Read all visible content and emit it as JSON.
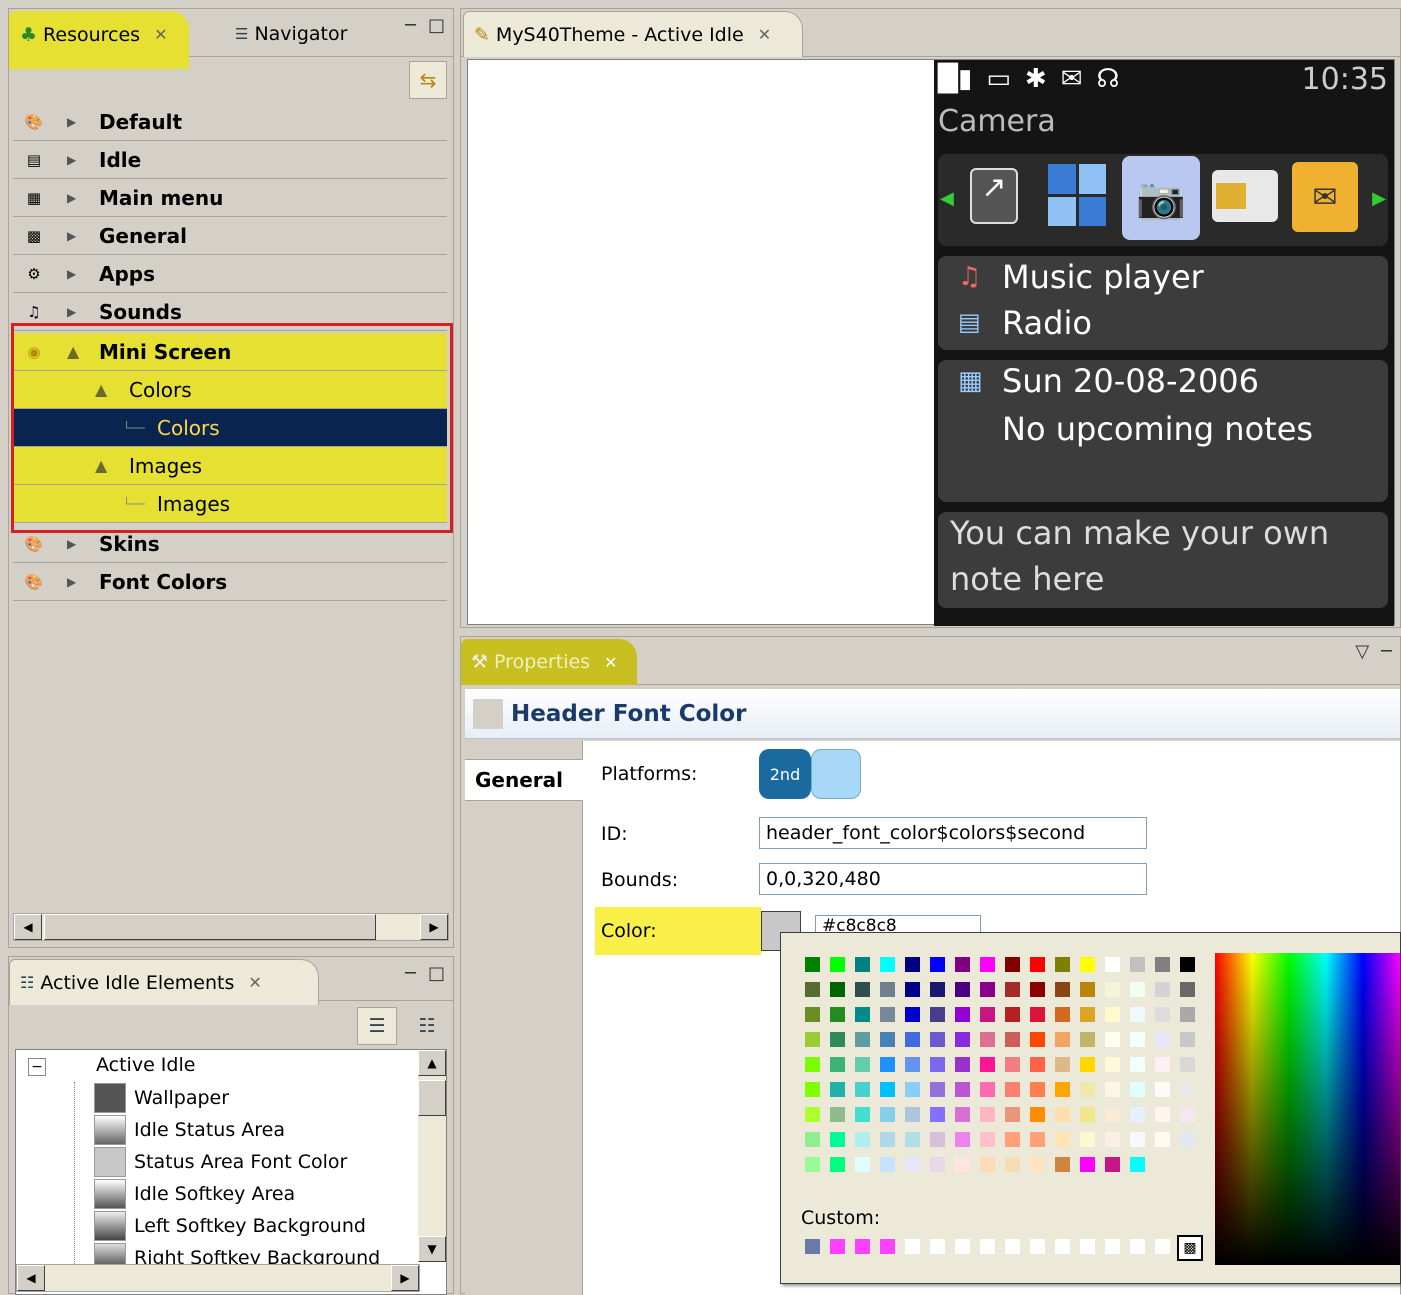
{
  "resources_panel": {
    "tabs": [
      {
        "label": "Resources"
      },
      {
        "label": "Navigator"
      }
    ],
    "tree": [
      {
        "label": "Default",
        "icon": "palette-icon"
      },
      {
        "label": "Idle",
        "icon": "window-icon"
      },
      {
        "label": "Main menu",
        "icon": "grid-icon"
      },
      {
        "label": "General",
        "icon": "panel-icon"
      },
      {
        "label": "Apps",
        "icon": "apps-icon"
      },
      {
        "label": "Sounds",
        "icon": "music-note-icon"
      },
      {
        "label": "Mini Screen",
        "icon": "mini-screen-icon"
      },
      {
        "label": "Colors"
      },
      {
        "label": "Colors"
      },
      {
        "label": "Images"
      },
      {
        "label": "Images"
      },
      {
        "label": "Skins",
        "icon": "palette-icon"
      },
      {
        "label": "Font Colors",
        "icon": "palette-icon"
      }
    ]
  },
  "elements_panel": {
    "tab_label": "Active Idle Elements",
    "root": "Active Idle",
    "items": [
      {
        "label": "Wallpaper",
        "swatch": "#555555"
      },
      {
        "label": "Idle Status Area",
        "swatch": "#888888"
      },
      {
        "label": "Status Area Font Color",
        "swatch": "#c8c8c8"
      },
      {
        "label": "Idle Softkey Area",
        "swatch": "#999999"
      },
      {
        "label": "Left Softkey Background",
        "swatch": "#777777"
      },
      {
        "label": "Right Softkey Background",
        "swatch": "#666666"
      }
    ]
  },
  "editor": {
    "tab_label": "MyS40Theme - Active Idle",
    "phone": {
      "time": "10:35",
      "title": "Camera",
      "app_icons": [
        "shortcut-icon",
        "windows-icon",
        "camera-icon",
        "sim-icon",
        "voicemail-icon"
      ],
      "music": "Music player",
      "radio": "Radio",
      "date": "Sun 20-08-2006",
      "notes": "No upcoming notes",
      "note_line1": "You can make your own",
      "note_line2": "note here"
    }
  },
  "properties": {
    "tab_label": "Properties",
    "header": "Header Font Color",
    "side_tab": "General",
    "platforms_label": "Platforms:",
    "platform_badge": "2nd",
    "id_label": "ID:",
    "id_value": "header_font_color$colors$second",
    "bounds_label": "Bounds:",
    "bounds_value": "0,0,320,480",
    "color_label": "Color:",
    "color_value": "#c8c8c8"
  },
  "color_picker": {
    "custom_label": "Custom:",
    "palette": [
      "#008000",
      "#00ff00",
      "#008080",
      "#00ffff",
      "#000080",
      "#0000ff",
      "#800080",
      "#ff00ff",
      "#800000",
      "#ff0000",
      "#808000",
      "#ffff00",
      "#ffffff",
      "#c0c0c0",
      "#808080",
      "#000000",
      "#556b2f",
      "#006400",
      "#2f4f4f",
      "#708090",
      "#00008b",
      "#191970",
      "#4b0082",
      "#8b008b",
      "#a52a2a",
      "#8b0000",
      "#8b4513",
      "#b8860b",
      "#f5f5dc",
      "#f0fff0",
      "#d3d3d3",
      "#696969",
      "#6b8e23",
      "#228b22",
      "#008b8b",
      "#778899",
      "#0000cd",
      "#483d8b",
      "#9400d3",
      "#c71585",
      "#b22222",
      "#dc143c",
      "#d2691e",
      "#daa520",
      "#fffacd",
      "#f0f8ff",
      "#dcdcdc",
      "#a9a9a9",
      "#9acd32",
      "#2e8b57",
      "#5f9ea0",
      "#4682b4",
      "#4169e1",
      "#6a5acd",
      "#8a2be2",
      "#db7093",
      "#cd5c5c",
      "#ff4500",
      "#f4a460",
      "#bdb76b",
      "#fffff0",
      "#f5fffa",
      "#e6e6fa",
      "#c8c8c8",
      "#7cfc00",
      "#3cb371",
      "#66cdaa",
      "#1e90ff",
      "#6495ed",
      "#7b68ee",
      "#9932cc",
      "#ff1493",
      "#f08080",
      "#ff6347",
      "#deb887",
      "#ffd700",
      "#fff8dc",
      "#f0ffff",
      "#fff0f5",
      "#d8d8d8",
      "#7fff00",
      "#20b2aa",
      "#48d1cc",
      "#00bfff",
      "#87cefa",
      "#9370db",
      "#ba55d3",
      "#ff69b4",
      "#fa8072",
      "#ff7f50",
      "#ffa500",
      "#eee8aa",
      "#fdf5e6",
      "#e0ffff",
      "#fffafa",
      "#e8e8e8",
      "#adff2f",
      "#8fbc8f",
      "#40e0d0",
      "#87ceeb",
      "#b0c4de",
      "#8470ff",
      "#da70d6",
      "#ffb6c1",
      "#e9967a",
      "#ff8c00",
      "#ffdead",
      "#f0e68c",
      "#faebd7",
      "#e6f0ff",
      "#fff5ee",
      "#f5e6f0",
      "#90ee90",
      "#00fa9a",
      "#afeeee",
      "#add8e6",
      "#b0e0e6",
      "#d8bfd8",
      "#ee82ee",
      "#ffc0cb",
      "#ffa07a",
      "#ffa07a",
      "#ffe4b5",
      "#fafad2",
      "#faf0e6",
      "#f8f8ff",
      "#fffaf0",
      "#e0e8f0",
      "#98fb98",
      "#00ff7f",
      "#e0ffff",
      "#c6e2ff",
      "#e6e6fa",
      "#e6d8e6",
      "#ffe4e1",
      "#ffdab9",
      "#f5deb3",
      "#ffe4c4",
      "#cd853f",
      "#ff00ff",
      "#c71585",
      "#00ffff"
    ],
    "custom": [
      "#6a7aa8",
      "#ff40ff",
      "#ff40ff",
      "#ff40ff",
      "#ffffff",
      "#ffffff",
      "#ffffff",
      "#ffffff",
      "#ffffff",
      "#ffffff",
      "#ffffff",
      "#ffffff",
      "#ffffff",
      "#ffffff",
      "#ffffff"
    ]
  }
}
